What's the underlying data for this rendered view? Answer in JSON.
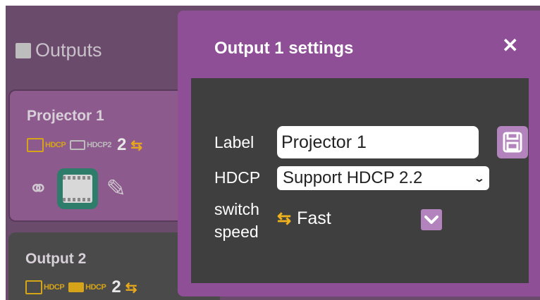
{
  "outputs_panel": {
    "title": "Outputs",
    "cards": [
      {
        "name": "Projector 1",
        "hdcp_badge": "HDCP",
        "hdcp2_badge": "HDCP2",
        "channel": "2"
      },
      {
        "name": "Output 2",
        "hdcp_badge": "HDCP",
        "hdcp2_badge": "HDCP",
        "channel": "2"
      }
    ]
  },
  "modal": {
    "title": "Output 1 settings",
    "close_icon": "close-icon",
    "label_field": {
      "label": "Label",
      "value": "Projector 1"
    },
    "hdcp_field": {
      "label": "HDCP",
      "selected": "Support HDCP 2.2"
    },
    "switch_speed": {
      "label_line1": "switch",
      "label_line2": "speed",
      "value": "Fast"
    }
  },
  "colors": {
    "modal_bg": "#8e4f97",
    "modal_body": "#3f3f3f",
    "accent_gold": "#d6a418",
    "teal": "#2e7d6b"
  }
}
